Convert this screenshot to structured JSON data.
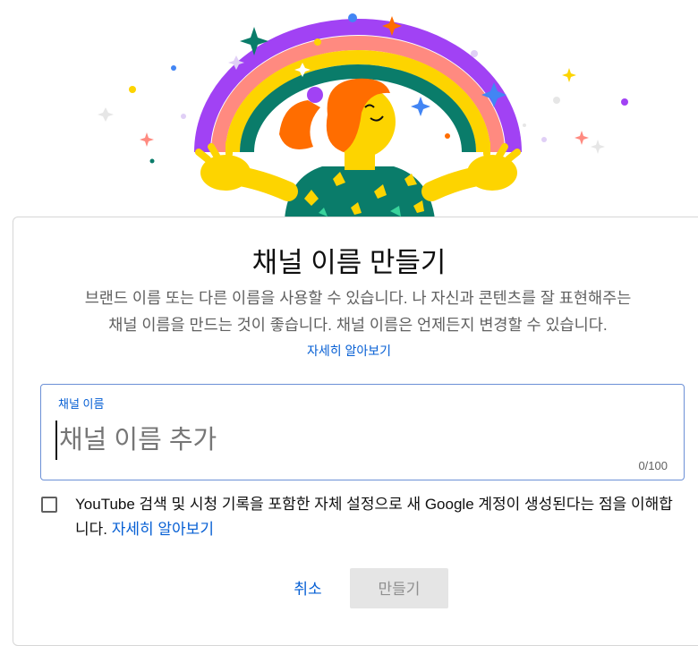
{
  "dialog": {
    "title": "채널 이름 만들기",
    "description_line1": "브랜드 이름 또는 다른 이름을 사용할 수 있습니다. 나 자신과 콘텐츠를 잘 표현해주는",
    "description_line2": "채널 이름을 만드는 것이 좋습니다. 채널 이름은 언제든지 변경할 수 있습니다.",
    "learn_more": "자세히 알아보기"
  },
  "name_field": {
    "label": "채널 이름",
    "value": "",
    "placeholder": "채널 이름 추가",
    "counter": "0/100"
  },
  "agreement": {
    "checked": false,
    "text": "YouTube 검색 및 시청 기록을 포함한 자체 설정으로 새 Google 계정이 생성된다는 점을 이해합니다.",
    "link": "자세히 알아보기"
  },
  "actions": {
    "cancel_label": "취소",
    "create_label": "만들기",
    "create_enabled": false
  },
  "colors": {
    "accent": "#065fd4",
    "rainbow_purple": "#a142f4",
    "rainbow_pink": "#ff8a80",
    "rainbow_yellow": "#fdd400",
    "rainbow_teal": "#0a7c6a",
    "hair_orange": "#ff6d00",
    "skin_yellow": "#fdd400",
    "shirt_green": "#0a7c6a"
  },
  "icons": {
    "illustration": "celebrating-person-rainbow-illustration",
    "checkbox": "checkbox-unchecked-icon"
  }
}
